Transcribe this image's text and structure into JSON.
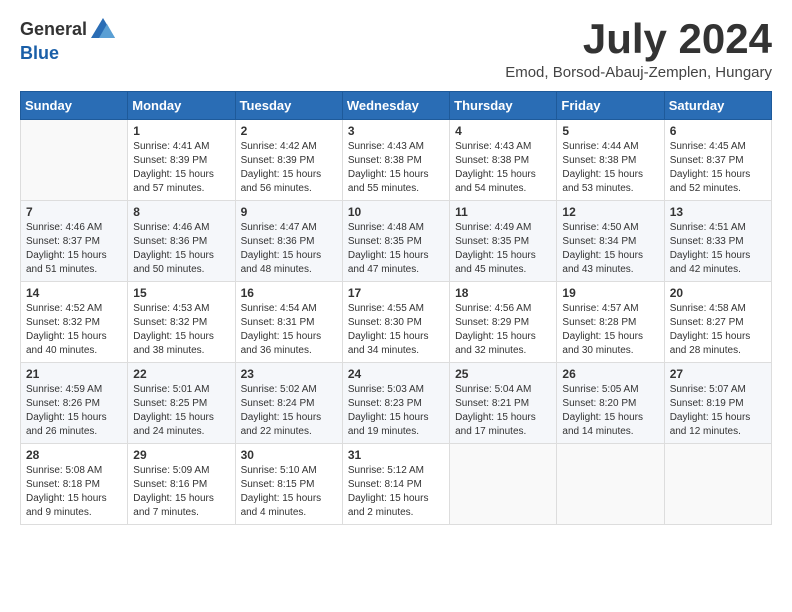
{
  "header": {
    "logo_general": "General",
    "logo_blue": "Blue",
    "month_title": "July 2024",
    "subtitle": "Emod, Borsod-Abauj-Zemplen, Hungary"
  },
  "weekdays": [
    "Sunday",
    "Monday",
    "Tuesday",
    "Wednesday",
    "Thursday",
    "Friday",
    "Saturday"
  ],
  "weeks": [
    [
      {
        "day": "",
        "empty": true
      },
      {
        "day": "1",
        "sunrise": "Sunrise: 4:41 AM",
        "sunset": "Sunset: 8:39 PM",
        "daylight": "Daylight: 15 hours and 57 minutes."
      },
      {
        "day": "2",
        "sunrise": "Sunrise: 4:42 AM",
        "sunset": "Sunset: 8:39 PM",
        "daylight": "Daylight: 15 hours and 56 minutes."
      },
      {
        "day": "3",
        "sunrise": "Sunrise: 4:43 AM",
        "sunset": "Sunset: 8:38 PM",
        "daylight": "Daylight: 15 hours and 55 minutes."
      },
      {
        "day": "4",
        "sunrise": "Sunrise: 4:43 AM",
        "sunset": "Sunset: 8:38 PM",
        "daylight": "Daylight: 15 hours and 54 minutes."
      },
      {
        "day": "5",
        "sunrise": "Sunrise: 4:44 AM",
        "sunset": "Sunset: 8:38 PM",
        "daylight": "Daylight: 15 hours and 53 minutes."
      },
      {
        "day": "6",
        "sunrise": "Sunrise: 4:45 AM",
        "sunset": "Sunset: 8:37 PM",
        "daylight": "Daylight: 15 hours and 52 minutes."
      }
    ],
    [
      {
        "day": "7",
        "sunrise": "Sunrise: 4:46 AM",
        "sunset": "Sunset: 8:37 PM",
        "daylight": "Daylight: 15 hours and 51 minutes."
      },
      {
        "day": "8",
        "sunrise": "Sunrise: 4:46 AM",
        "sunset": "Sunset: 8:36 PM",
        "daylight": "Daylight: 15 hours and 50 minutes."
      },
      {
        "day": "9",
        "sunrise": "Sunrise: 4:47 AM",
        "sunset": "Sunset: 8:36 PM",
        "daylight": "Daylight: 15 hours and 48 minutes."
      },
      {
        "day": "10",
        "sunrise": "Sunrise: 4:48 AM",
        "sunset": "Sunset: 8:35 PM",
        "daylight": "Daylight: 15 hours and 47 minutes."
      },
      {
        "day": "11",
        "sunrise": "Sunrise: 4:49 AM",
        "sunset": "Sunset: 8:35 PM",
        "daylight": "Daylight: 15 hours and 45 minutes."
      },
      {
        "day": "12",
        "sunrise": "Sunrise: 4:50 AM",
        "sunset": "Sunset: 8:34 PM",
        "daylight": "Daylight: 15 hours and 43 minutes."
      },
      {
        "day": "13",
        "sunrise": "Sunrise: 4:51 AM",
        "sunset": "Sunset: 8:33 PM",
        "daylight": "Daylight: 15 hours and 42 minutes."
      }
    ],
    [
      {
        "day": "14",
        "sunrise": "Sunrise: 4:52 AM",
        "sunset": "Sunset: 8:32 PM",
        "daylight": "Daylight: 15 hours and 40 minutes."
      },
      {
        "day": "15",
        "sunrise": "Sunrise: 4:53 AM",
        "sunset": "Sunset: 8:32 PM",
        "daylight": "Daylight: 15 hours and 38 minutes."
      },
      {
        "day": "16",
        "sunrise": "Sunrise: 4:54 AM",
        "sunset": "Sunset: 8:31 PM",
        "daylight": "Daylight: 15 hours and 36 minutes."
      },
      {
        "day": "17",
        "sunrise": "Sunrise: 4:55 AM",
        "sunset": "Sunset: 8:30 PM",
        "daylight": "Daylight: 15 hours and 34 minutes."
      },
      {
        "day": "18",
        "sunrise": "Sunrise: 4:56 AM",
        "sunset": "Sunset: 8:29 PM",
        "daylight": "Daylight: 15 hours and 32 minutes."
      },
      {
        "day": "19",
        "sunrise": "Sunrise: 4:57 AM",
        "sunset": "Sunset: 8:28 PM",
        "daylight": "Daylight: 15 hours and 30 minutes."
      },
      {
        "day": "20",
        "sunrise": "Sunrise: 4:58 AM",
        "sunset": "Sunset: 8:27 PM",
        "daylight": "Daylight: 15 hours and 28 minutes."
      }
    ],
    [
      {
        "day": "21",
        "sunrise": "Sunrise: 4:59 AM",
        "sunset": "Sunset: 8:26 PM",
        "daylight": "Daylight: 15 hours and 26 minutes."
      },
      {
        "day": "22",
        "sunrise": "Sunrise: 5:01 AM",
        "sunset": "Sunset: 8:25 PM",
        "daylight": "Daylight: 15 hours and 24 minutes."
      },
      {
        "day": "23",
        "sunrise": "Sunrise: 5:02 AM",
        "sunset": "Sunset: 8:24 PM",
        "daylight": "Daylight: 15 hours and 22 minutes."
      },
      {
        "day": "24",
        "sunrise": "Sunrise: 5:03 AM",
        "sunset": "Sunset: 8:23 PM",
        "daylight": "Daylight: 15 hours and 19 minutes."
      },
      {
        "day": "25",
        "sunrise": "Sunrise: 5:04 AM",
        "sunset": "Sunset: 8:21 PM",
        "daylight": "Daylight: 15 hours and 17 minutes."
      },
      {
        "day": "26",
        "sunrise": "Sunrise: 5:05 AM",
        "sunset": "Sunset: 8:20 PM",
        "daylight": "Daylight: 15 hours and 14 minutes."
      },
      {
        "day": "27",
        "sunrise": "Sunrise: 5:07 AM",
        "sunset": "Sunset: 8:19 PM",
        "daylight": "Daylight: 15 hours and 12 minutes."
      }
    ],
    [
      {
        "day": "28",
        "sunrise": "Sunrise: 5:08 AM",
        "sunset": "Sunset: 8:18 PM",
        "daylight": "Daylight: 15 hours and 9 minutes."
      },
      {
        "day": "29",
        "sunrise": "Sunrise: 5:09 AM",
        "sunset": "Sunset: 8:16 PM",
        "daylight": "Daylight: 15 hours and 7 minutes."
      },
      {
        "day": "30",
        "sunrise": "Sunrise: 5:10 AM",
        "sunset": "Sunset: 8:15 PM",
        "daylight": "Daylight: 15 hours and 4 minutes."
      },
      {
        "day": "31",
        "sunrise": "Sunrise: 5:12 AM",
        "sunset": "Sunset: 8:14 PM",
        "daylight": "Daylight: 15 hours and 2 minutes."
      },
      {
        "day": "",
        "empty": true
      },
      {
        "day": "",
        "empty": true
      },
      {
        "day": "",
        "empty": true
      }
    ]
  ]
}
